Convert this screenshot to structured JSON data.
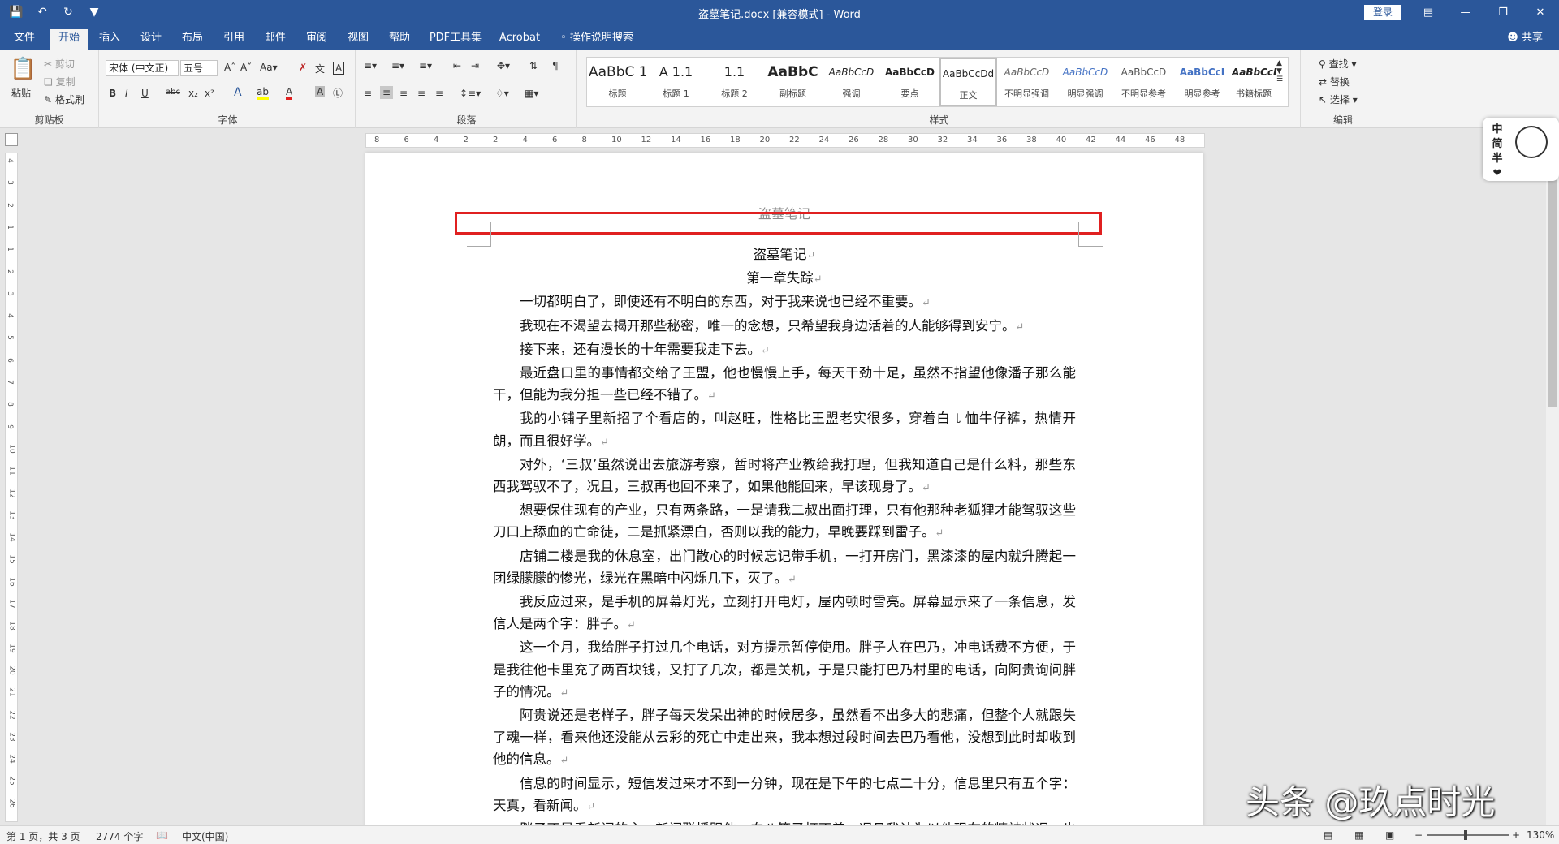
{
  "titlebar": {
    "title": "盗墓笔记.docx [兼容模式] - Word",
    "login": "登录",
    "qa_icons": [
      "save-icon",
      "undo-icon",
      "redo-icon",
      "customize-icon"
    ]
  },
  "tabs": [
    {
      "label": "文件"
    },
    {
      "label": "开始"
    },
    {
      "label": "插入"
    },
    {
      "label": "设计"
    },
    {
      "label": "布局"
    },
    {
      "label": "引用"
    },
    {
      "label": "邮件"
    },
    {
      "label": "审阅"
    },
    {
      "label": "视图"
    },
    {
      "label": "帮助"
    },
    {
      "label": "PDF工具集"
    },
    {
      "label": "Acrobat"
    }
  ],
  "tell_me": "操作说明搜索",
  "share": "共享",
  "ribbon": {
    "clipboard": {
      "label": "剪贴板",
      "paste": "粘贴",
      "cut": "剪切",
      "copy": "复制",
      "painter": "格式刷"
    },
    "font": {
      "label": "字体",
      "font_name": "宋体 (中文正)",
      "font_size": "五号"
    },
    "paragraph": {
      "label": "段落"
    },
    "styles": {
      "label": "样式",
      "items": [
        {
          "preview": "AaBbC 1",
          "name": "标题"
        },
        {
          "preview": "A 1.1",
          "name": "标题 1"
        },
        {
          "preview": "1.1",
          "name": "标题 2"
        },
        {
          "preview": "AaBbC",
          "name": "副标题"
        },
        {
          "preview": "AaBbCcD",
          "name": "强调"
        },
        {
          "preview": "AaBbCcD",
          "name": "要点"
        },
        {
          "preview": "AaBbCcDd",
          "name": "正文"
        },
        {
          "preview": "AaBbCcD",
          "name": "不明显强调"
        },
        {
          "preview": "AaBbCcD",
          "name": "明显强调"
        },
        {
          "preview": "AaBbCcD",
          "name": "不明显参考"
        },
        {
          "preview": "AaBbCcI",
          "name": "明显参考"
        },
        {
          "preview": "AaBbCcD",
          "name": "书籍标题"
        }
      ]
    },
    "editing": {
      "label": "编辑",
      "find": "查找",
      "replace": "替换",
      "select": "选择"
    }
  },
  "ruler_h_numbers": [
    "8",
    "6",
    "4",
    "2",
    "2",
    "4",
    "6",
    "8",
    "10",
    "12",
    "14",
    "16",
    "18",
    "20",
    "22",
    "24",
    "26",
    "28",
    "30",
    "32",
    "34",
    "36",
    "38",
    "40",
    "42",
    "44",
    "46",
    "48"
  ],
  "ruler_v_numbers": [
    "4",
    "3",
    "2",
    "1",
    "1",
    "2",
    "3",
    "4",
    "5",
    "6",
    "7",
    "8",
    "9",
    "10",
    "11",
    "12",
    "13",
    "14",
    "15",
    "16",
    "17",
    "18",
    "19",
    "20",
    "21",
    "22",
    "23",
    "24",
    "25",
    "26"
  ],
  "document": {
    "header": "盗墓笔记",
    "title": "盗墓笔记",
    "chapter": "第一章失踪",
    "paragraphs": [
      "一切都明白了，即使还有不明白的东西，对于我来说也已经不重要。",
      "我现在不渴望去揭开那些秘密，唯一的念想，只希望我身边活着的人能够得到安宁。",
      "接下来，还有漫长的十年需要我走下去。",
      "最近盘口里的事情都交给了王盟，他也慢慢上手，每天干劲十足，虽然不指望他像潘子那么能干，但能为我分担一些已经不错了。",
      "我的小铺子里新招了个看店的，叫赵旺，性格比王盟老实很多，穿着白 t 恤牛仔裤，热情开朗，而且很好学。",
      "对外，‘三叔’虽然说出去旅游考察，暂时将产业教给我打理，但我知道自己是什么料，那些东西我驾驭不了，况且，三叔再也回不来了，如果他能回来，早该现身了。",
      "想要保住现有的产业，只有两条路，一是请我二叔出面打理，只有他那种老狐狸才能驾驭这些刀口上舔血的亡命徒，二是抓紧漂白，否则以我的能力，早晚要踩到雷子。",
      "店铺二楼是我的休息室，出门散心的时候忘记带手机，一打开房门，黑漆漆的屋内就升腾起一团绿朦朦的惨光，绿光在黑暗中闪烁几下，灭了。",
      "我反应过来，是手机的屏幕灯光，立刻打开电灯，屋内顿时雪亮。屏幕显示来了一条信息，发信人是两个字：胖子。",
      "这一个月，我给胖子打过几个电话，对方提示暂停使用。胖子人在巴乃，冲电话费不方便，于是我往他卡里充了两百块钱，又打了几次，都是关机，于是只能打巴乃村里的电话，向阿贵询问胖子的情况。",
      "阿贵说还是老样子，胖子每天发呆出神的时候居多，虽然看不出多大的悲痛，但整个人就跟失了魂一样，看来他还没能从云彩的死亡中走出来，我本想过段时间去巴乃看他，没想到此时却收到他的信息。",
      "信息的时间显示，短信发过来才不到一分钟，现在是下午的七点二十分，信息里只有五个字：天真，看新闻。",
      "胖子不是看新闻的主，新闻联播跟他一向八竿子打不着，况且我认为以他现在的精神状况，也看不进新闻，那么他是想告诉我什么？难道出什么事了？"
    ]
  },
  "status": {
    "page": "第 1 页，共 3 页",
    "words": "2774 个字",
    "lang": "中文(中国)",
    "zoom": "130%"
  },
  "ime": {
    "chars": [
      "中",
      "简",
      "半"
    ]
  },
  "watermark": "头条 @玖点时光"
}
